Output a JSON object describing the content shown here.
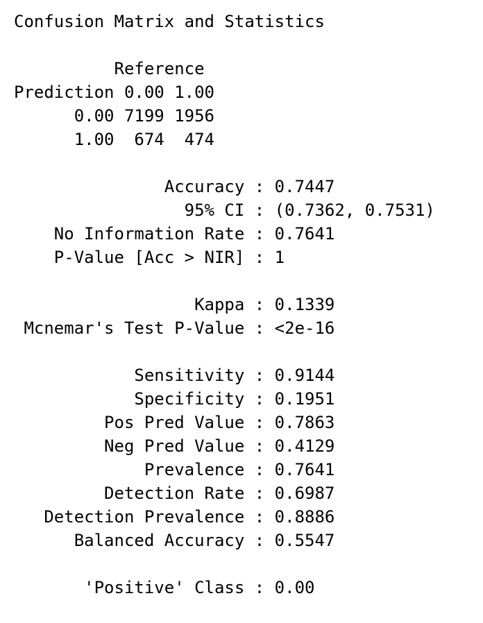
{
  "title": "Confusion Matrix and Statistics",
  "matrix": {
    "reference_header": "          Reference",
    "prediction_header": "Prediction 0.00 1.00",
    "rows": [
      "      0.00 7199 1956",
      "      1.00  674  474"
    ]
  },
  "overall": [
    "               Accuracy : 0.7447",
    "                 95% CI : (0.7362, 0.7531)",
    "    No Information Rate : 0.7641",
    "    P-Value [Acc > NIR] : 1"
  ],
  "agreement": [
    "                  Kappa : 0.1339",
    " Mcnemar's Test P-Value : <2e-16"
  ],
  "by_class": [
    "            Sensitivity : 0.9144",
    "            Specificity : 0.1951",
    "         Pos Pred Value : 0.7863",
    "         Neg Pred Value : 0.4129",
    "             Prevalence : 0.7641",
    "         Detection Rate : 0.6987",
    "   Detection Prevalence : 0.8886",
    "      Balanced Accuracy : 0.5547"
  ],
  "positive_class": "       'Positive' Class : 0.00"
}
